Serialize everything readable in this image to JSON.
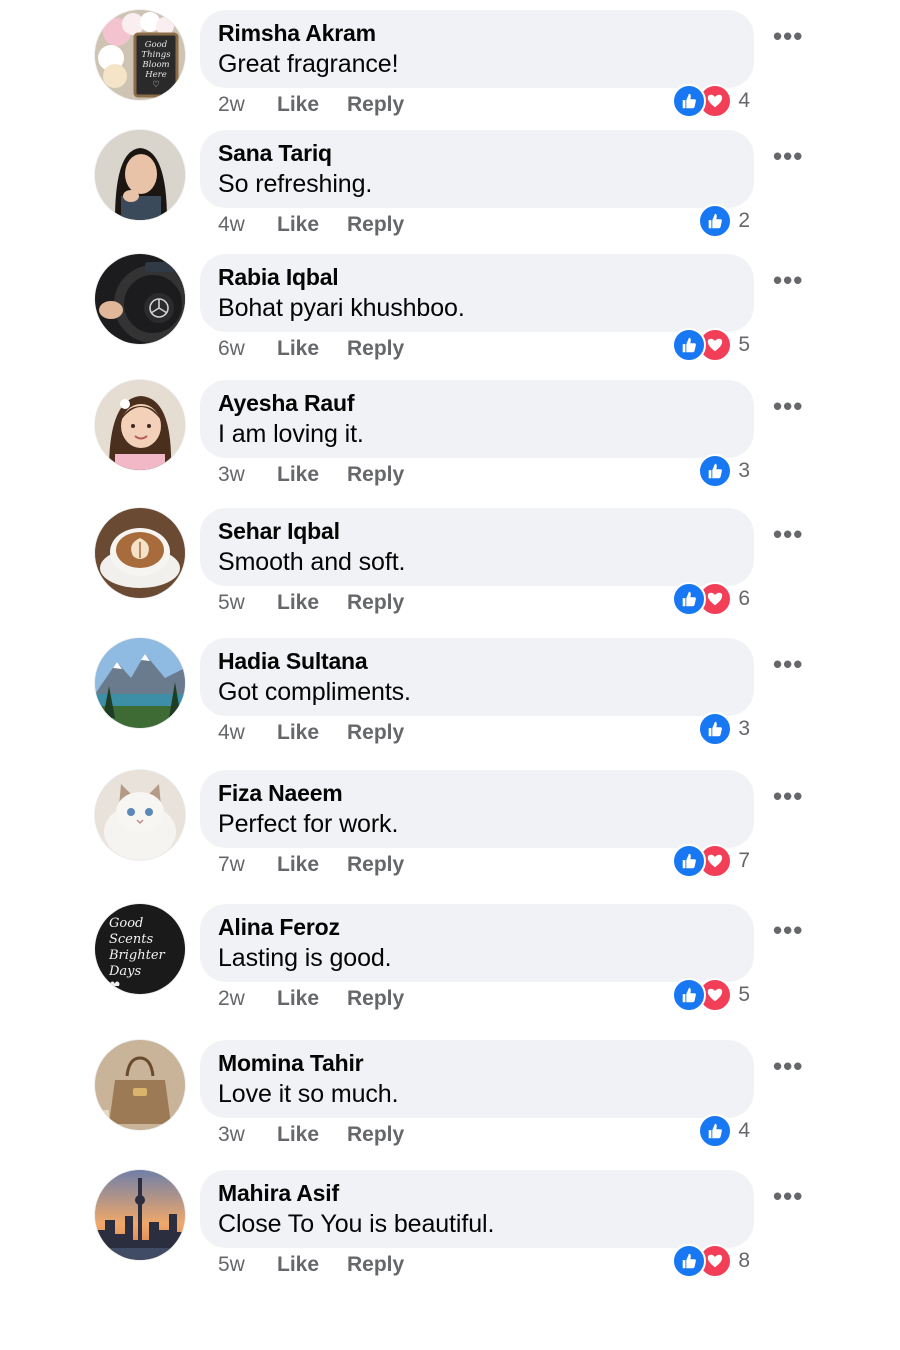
{
  "colors": {
    "bubble": "#f0f2f5",
    "meta_text": "#65676b",
    "like_blue": "#1877f2",
    "love_red": "#f33e58"
  },
  "comments": [
    {
      "author": "Rimsha Akram",
      "text": "Great fragrance!",
      "time": "2w",
      "like_label": "Like",
      "reply_label": "Reply",
      "reactions": [
        "like",
        "love"
      ],
      "reaction_count": "4",
      "avatar": "flowers-good-things-bloom-here",
      "avatar_text": "Good Things Bloom Here ♡"
    },
    {
      "author": "Sana Tariq",
      "text": "So refreshing.",
      "time": "4w",
      "like_label": "Like",
      "reply_label": "Reply",
      "reactions": [
        "like"
      ],
      "reaction_count": "2",
      "avatar": "girl-portrait"
    },
    {
      "author": "Rabia Iqbal",
      "text": "Bohat pyari khushboo.",
      "time": "6w",
      "like_label": "Like",
      "reply_label": "Reply",
      "reactions": [
        "like",
        "love"
      ],
      "reaction_count": "5",
      "avatar": "car-steering-wheel"
    },
    {
      "author": "Ayesha Rauf",
      "text": "I am loving it.",
      "time": "3w",
      "like_label": "Like",
      "reply_label": "Reply",
      "reactions": [
        "like"
      ],
      "reaction_count": "3",
      "avatar": "little-girl"
    },
    {
      "author": "Sehar Iqbal",
      "text": "Smooth and soft.",
      "time": "5w",
      "like_label": "Like",
      "reply_label": "Reply",
      "reactions": [
        "like",
        "love"
      ],
      "reaction_count": "6",
      "avatar": "latte-art-coffee"
    },
    {
      "author": "Hadia Sultana",
      "text": "Got compliments.",
      "time": "4w",
      "like_label": "Like",
      "reply_label": "Reply",
      "reactions": [
        "like"
      ],
      "reaction_count": "3",
      "avatar": "mountain-lake"
    },
    {
      "author": "Fiza Naeem",
      "text": "Perfect for work.",
      "time": "7w",
      "like_label": "Like",
      "reply_label": "Reply",
      "reactions": [
        "like",
        "love"
      ],
      "reaction_count": "7",
      "avatar": "white-cat"
    },
    {
      "author": "Alina Feroz",
      "text": "Lasting is good.",
      "time": "2w",
      "like_label": "Like",
      "reply_label": "Reply",
      "reactions": [
        "like",
        "love"
      ],
      "reaction_count": "5",
      "avatar": "good-scents-brighter-days",
      "avatar_text": "Good Scents Brighter Days ♥"
    },
    {
      "author": "Momina Tahir",
      "text": "Love it so much.",
      "time": "3w",
      "like_label": "Like",
      "reply_label": "Reply",
      "reactions": [
        "like"
      ],
      "reaction_count": "4",
      "avatar": "handbag"
    },
    {
      "author": "Mahira Asif",
      "text": "Close To You is beautiful.",
      "time": "5w",
      "like_label": "Like",
      "reply_label": "Reply",
      "reactions": [
        "like",
        "love"
      ],
      "reaction_count": "8",
      "avatar": "city-skyline-sunset"
    }
  ],
  "more_glyph": "•••"
}
